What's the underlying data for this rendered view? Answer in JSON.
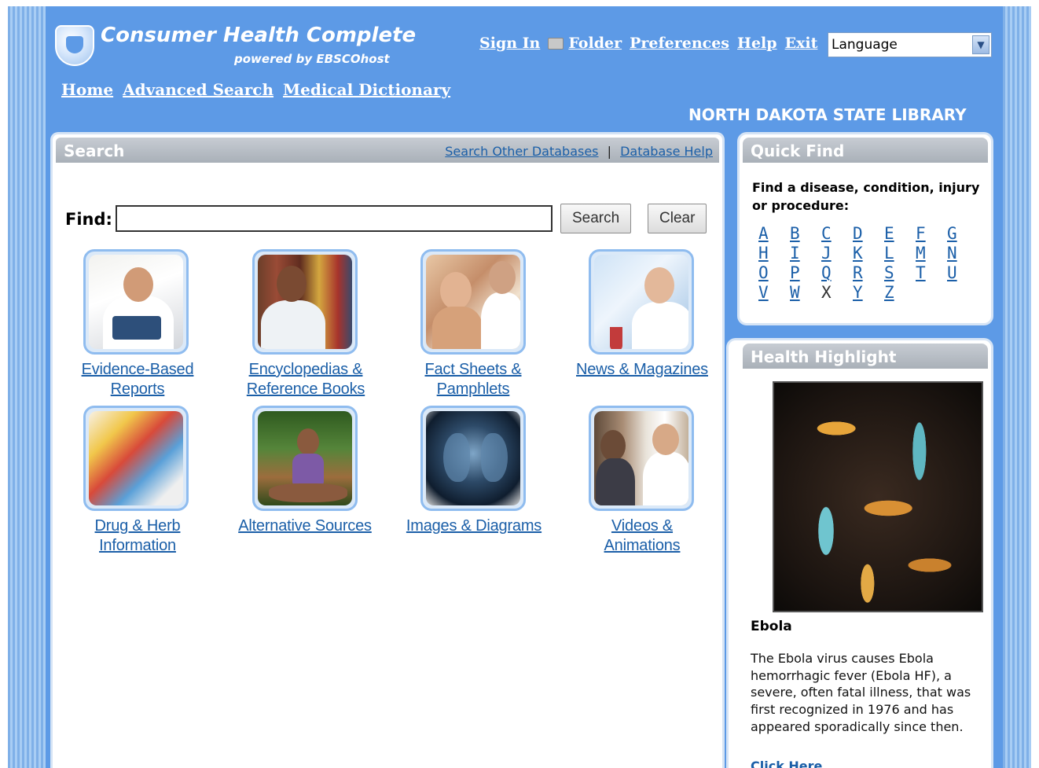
{
  "brand": {
    "title": "Consumer Health Complete",
    "subtitle": "powered by EBSCOhost"
  },
  "top_links": {
    "sign_in": "Sign In",
    "folder": "Folder",
    "preferences": "Preferences",
    "help": "Help",
    "exit": "Exit"
  },
  "language_select": {
    "selected": "Language"
  },
  "nav": {
    "home": "Home",
    "advanced_search": "Advanced Search",
    "medical_dictionary": "Medical Dictionary"
  },
  "institution": "NORTH DAKOTA STATE LIBRARY",
  "search_panel": {
    "title": "Search",
    "search_other": "Search Other Databases",
    "separator": "|",
    "database_help": "Database Help",
    "find_label": "Find:",
    "find_value": "",
    "search_button": "Search",
    "clear_button": "Clear"
  },
  "tiles": [
    {
      "line1": "Evidence-Based",
      "line2": "Reports"
    },
    {
      "line1": "Encyclopedias &",
      "line2": "Reference Books"
    },
    {
      "line1": "Fact Sheets &",
      "line2": "Pamphlets"
    },
    {
      "line1": "News & Magazines",
      "line2": ""
    },
    {
      "line1": "Drug & Herb",
      "line2": "Information"
    },
    {
      "line1": "Alternative Sources",
      "line2": ""
    },
    {
      "line1": "Images & Diagrams",
      "line2": ""
    },
    {
      "line1": "Videos &",
      "line2": "Animations"
    }
  ],
  "quick_find": {
    "title": "Quick Find",
    "description": "Find a disease, condition, injury or procedure:",
    "letters": [
      "A",
      "B",
      "C",
      "D",
      "E",
      "F",
      "G",
      "H",
      "I",
      "J",
      "K",
      "L",
      "M",
      "N",
      "O",
      "P",
      "Q",
      "R",
      "S",
      "T",
      "U",
      "V",
      "W",
      "X",
      "Y",
      "Z"
    ],
    "unlinked": [
      "X"
    ]
  },
  "health_highlight": {
    "title": "Health Highlight",
    "name": "Ebola",
    "text": "The Ebola virus causes Ebola hemorrhagic fever (Ebola HF), a severe, often fatal illness, that was first recognized in 1976 and has appeared sporadically since then.",
    "more_link": "Click Here"
  }
}
